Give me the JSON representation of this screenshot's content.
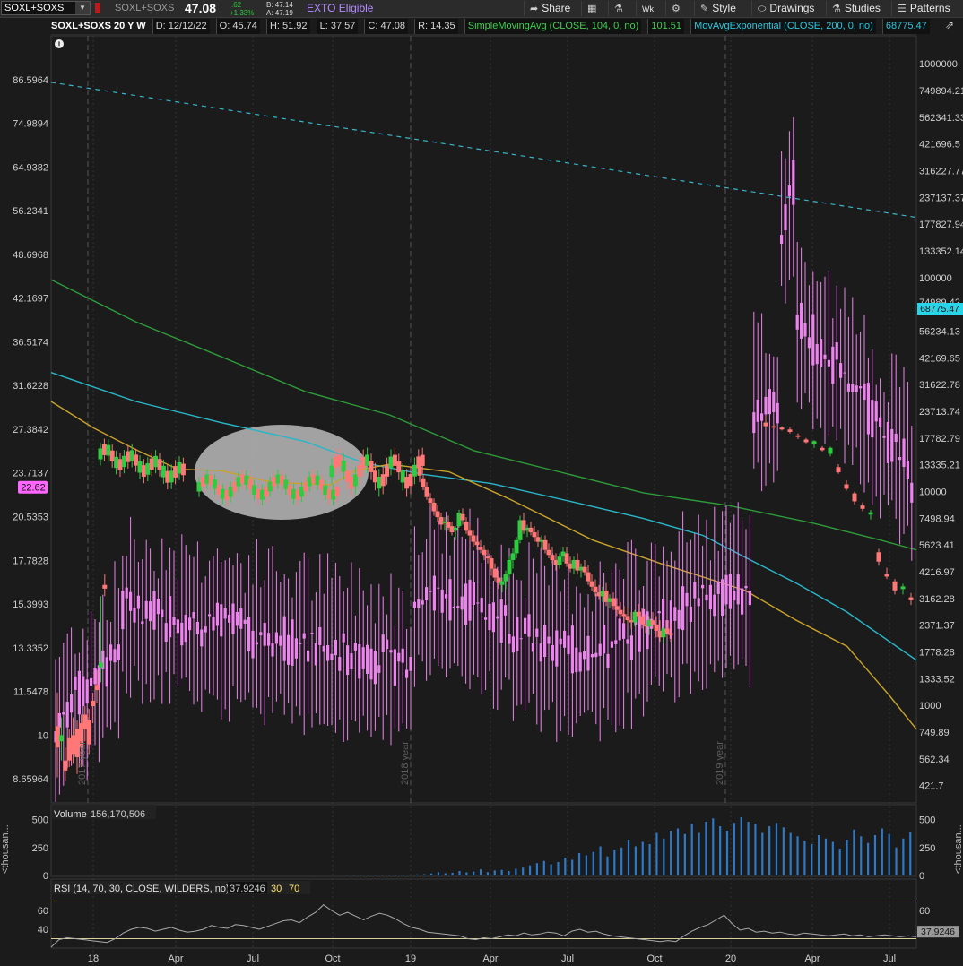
{
  "toolbar": {
    "symbol": "SOXL+SOXS",
    "symbol_label": "SOXL+SOXS",
    "last": "47.08",
    "net_change": ".62",
    "pct_change": "+1.33%",
    "bid": "B: 47.14",
    "ask": "A: 47.19",
    "exto": "EXTO Eligible",
    "share": "Share",
    "wk": "Wk",
    "style": "Style",
    "drawings": "Drawings",
    "studies": "Studies",
    "patterns": "Patterns"
  },
  "header": {
    "title": "SOXL+SOXS 20 Y W",
    "date": "D: 12/12/22",
    "open": "O: 45.74",
    "high": "H: 51.92",
    "low": "L: 37.57",
    "close": "C: 47.08",
    "range": "R: 14.35",
    "sma_label": "SimpleMovingAvg (CLOSE, 104, 0, no)",
    "sma_value": "101.51",
    "ema_label": "MovAvgExponential (CLOSE, 200, 0, no)",
    "ema_value": "68775.47"
  },
  "colors": {
    "up": "#2ecc40",
    "down": "#ff7777",
    "pink": "#ee82ee",
    "ma_sma": "#c8a22a",
    "ma_cyan": "#29b6c8",
    "ma_green": "#2e9b3a",
    "trend": "#38b6c8"
  },
  "chart_data": [
    {
      "type": "candlestick",
      "title": "SOXL+SOXS 20 Y W",
      "left_axis_ticks": [
        "86.5964",
        "74.9894",
        "64.9382",
        "56.2341",
        "48.6968",
        "42.1697",
        "36.5174",
        "31.6228",
        "27.3842",
        "23.7137",
        "20.5353",
        "17.7828",
        "15.3993",
        "13.3352",
        "11.5478",
        "10",
        "8.65964"
      ],
      "right_axis_ticks": [
        "1000000",
        "749894.21",
        "562341.33",
        "421696.5",
        "316227.77",
        "237137.37",
        "177827.94",
        "133352.14",
        "100000",
        "56234.13",
        "42169.65",
        "31622.78",
        "23713.74",
        "17782.79",
        "13335.21",
        "10000",
        "7498.94",
        "5623.41",
        "4216.97",
        "3162.28",
        "2371.37",
        "1778.28",
        "1333.52",
        "1000",
        "749.89",
        "562.34",
        "421.7"
      ],
      "right_axis_hidden_tick": "74989.42",
      "left_price_label": "22.62",
      "right_price_label": "68775.47",
      "x_ticks": [
        "18",
        "Apr",
        "Jul",
        "Oct",
        "19",
        "Apr",
        "Jul",
        "Oct",
        "20",
        "Apr",
        "Jul"
      ],
      "year_labels": [
        "2017 year",
        "2018 year",
        "2019 year"
      ],
      "left_scale": {
        "log": true,
        "min": 8.0,
        "max": 100
      },
      "right_scale": {
        "log": true,
        "min": 350,
        "max": 1350000
      },
      "ohlc_left_scale": [
        [
          10.3,
          11.5,
          8.7,
          9.6
        ],
        [
          9.8,
          10.6,
          9.2,
          10.0
        ],
        [
          9.2,
          9.6,
          8.6,
          8.9
        ],
        [
          9.9,
          10.2,
          9.0,
          9.2
        ],
        [
          10.0,
          10.6,
          9.1,
          9.4
        ],
        [
          10.2,
          10.5,
          8.8,
          9.3
        ],
        [
          10.4,
          10.7,
          9.0,
          9.6
        ],
        [
          10.7,
          11.0,
          9.8,
          10.2
        ],
        [
          10.5,
          10.9,
          9.4,
          9.7
        ],
        [
          11.2,
          11.5,
          10.4,
          11.0
        ],
        [
          11.8,
          12.4,
          11.1,
          11.6
        ],
        [
          12.5,
          15.8,
          11.9,
          12.7
        ],
        [
          16.4,
          17.0,
          15.8,
          16.2
        ]
      ],
      "ohlc_right_scale": [
        [
          21000,
          22600,
          19800,
          20200
        ],
        [
          20200,
          20700,
          19600,
          19900
        ],
        [
          19900,
          20200,
          19300,
          19500
        ],
        [
          19500,
          19900,
          18700,
          19000
        ],
        [
          18300,
          18700,
          17600,
          18000
        ],
        [
          17500,
          17800,
          16800,
          17000
        ],
        [
          16600,
          17400,
          16000,
          17200
        ],
        [
          16000,
          16300,
          15400,
          15600
        ],
        [
          15000,
          16200,
          14600,
          16000
        ],
        [
          13000,
          13400,
          12100,
          12300
        ],
        [
          10800,
          11300,
          10100,
          10300
        ],
        [
          9800,
          10000,
          8700,
          9000
        ],
        [
          8600,
          8900,
          8100,
          8300
        ],
        [
          7800,
          8200,
          7400,
          8000
        ],
        [
          5200,
          5400,
          4500,
          4700
        ],
        [
          4100,
          4400,
          3900,
          4000
        ],
        [
          3800,
          3900,
          3300,
          3450
        ],
        [
          3500,
          3700,
          3300,
          3600
        ],
        [
          3200,
          3350,
          2950,
          3100
        ]
      ],
      "sma_104_key_points_left_scale": [
        [
          0,
          30.0
        ],
        [
          50,
          27.5
        ],
        [
          100,
          25.6
        ],
        [
          150,
          24.0
        ],
        [
          200,
          23.9
        ],
        [
          260,
          23.0
        ],
        [
          330,
          22.8
        ],
        [
          360,
          23.9
        ],
        [
          400,
          24.4
        ],
        [
          470,
          23.8
        ],
        [
          540,
          21.8
        ],
        [
          640,
          19.0
        ],
        [
          720,
          17.6
        ],
        [
          820,
          16.1
        ],
        [
          880,
          14.6
        ],
        [
          940,
          13.4
        ],
        [
          990,
          11.4
        ],
        [
          1022,
          10.2
        ]
      ],
      "ema_200_key_points_left_scale": [
        [
          0,
          33.0
        ],
        [
          100,
          30.0
        ],
        [
          200,
          28.0
        ],
        [
          300,
          26.3
        ],
        [
          370,
          24.5
        ],
        [
          440,
          23.6
        ],
        [
          520,
          22.9
        ],
        [
          620,
          21.5
        ],
        [
          700,
          20.4
        ],
        [
          770,
          19.3
        ],
        [
          830,
          17.7
        ],
        [
          880,
          16.5
        ],
        [
          940,
          15.0
        ],
        [
          1022,
          12.8
        ]
      ],
      "ema_slow_key_points_left_scale": [
        [
          0,
          44.8
        ],
        [
          100,
          39.0
        ],
        [
          200,
          34.8
        ],
        [
          300,
          31.0
        ],
        [
          400,
          28.7
        ],
        [
          500,
          25.5
        ],
        [
          600,
          23.8
        ],
        [
          700,
          22.2
        ],
        [
          800,
          21.3
        ],
        [
          900,
          20.1
        ],
        [
          980,
          19.0
        ],
        [
          1022,
          18.4
        ]
      ],
      "trendline_left_scale": [
        [
          57,
          85.8
        ],
        [
          1022,
          55.0
        ]
      ],
      "ellipse_note": "highlighted consolidation region"
    },
    {
      "type": "bar",
      "title": "Volume",
      "value_label": "156,170,506",
      "axis_label": "<thousan...",
      "y_ticks": [
        "500",
        "250",
        "0"
      ],
      "ylim": [
        0,
        600
      ],
      "values_thousands": [
        0,
        0,
        2,
        3,
        4,
        5,
        6,
        4,
        5,
        8,
        6,
        3,
        10,
        12,
        18,
        30,
        20,
        25,
        40,
        28,
        35,
        55,
        30,
        45,
        50,
        40,
        60,
        70,
        90,
        110,
        130,
        100,
        120,
        160,
        140,
        200,
        180,
        210,
        260,
        170,
        230,
        250,
        320,
        260,
        300,
        280,
        380,
        330,
        400,
        420,
        370,
        460,
        380,
        480,
        510,
        440,
        400,
        470,
        520,
        480,
        460,
        380,
        440,
        470,
        430,
        380,
        350,
        310,
        280,
        360,
        330,
        300,
        240,
        320,
        410,
        350,
        290,
        360,
        420,
        370,
        250,
        330,
        390
      ]
    },
    {
      "type": "line",
      "title": "RSI (14, 70, 30, CLOSE, WILDERS, no)",
      "value_label": "37.9246",
      "level_30": "30",
      "level_70": "70",
      "y_ticks": [
        "60",
        "40"
      ],
      "ylim": [
        20,
        80
      ],
      "values": [
        21,
        29,
        31,
        30,
        29,
        28,
        27,
        26,
        30,
        36,
        40,
        42,
        41,
        38,
        40,
        42,
        39,
        37,
        38,
        40,
        44,
        42,
        41,
        45,
        44,
        42,
        40,
        43,
        46,
        49,
        50,
        47,
        53,
        58,
        66,
        60,
        55,
        58,
        54,
        50,
        54,
        57,
        55,
        51,
        46,
        42,
        40,
        37,
        36,
        35,
        34,
        33,
        30,
        29,
        31,
        30,
        32,
        34,
        33,
        36,
        34,
        35,
        37,
        36,
        33,
        38,
        40,
        37,
        38,
        35,
        33,
        32,
        31,
        30,
        29,
        28,
        27,
        28,
        27,
        33,
        38,
        42,
        45,
        50,
        55,
        46,
        39,
        41,
        37,
        38,
        36,
        37,
        35,
        34,
        36,
        35,
        34,
        33,
        34,
        35,
        33,
        34,
        32,
        33,
        34,
        33,
        32,
        33,
        32
      ]
    }
  ]
}
